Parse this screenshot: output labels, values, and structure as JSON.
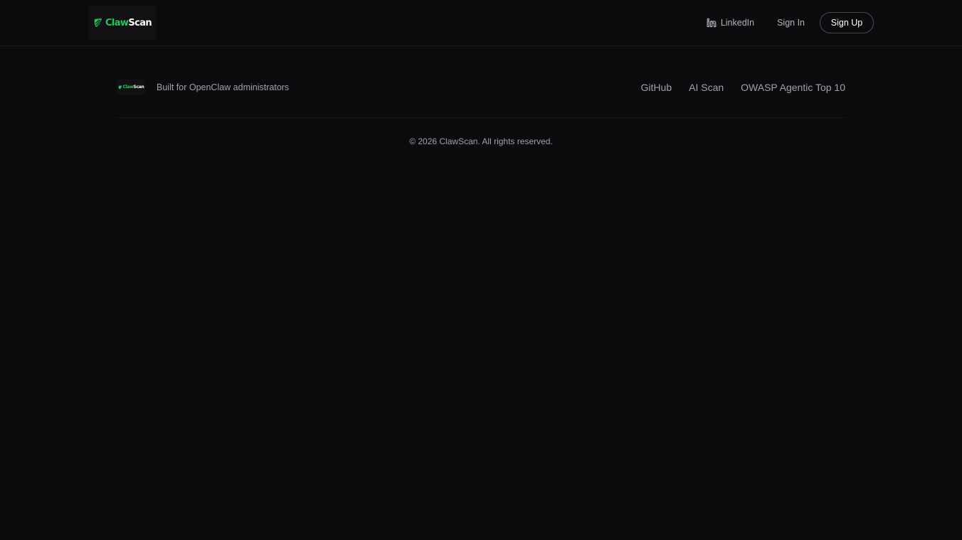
{
  "header": {
    "logo": {
      "claw": "Claw",
      "scan": "Scan",
      "icon": "shield-leaf-icon"
    },
    "nav": {
      "linkedin_label": "LinkedIn",
      "linkedin_icon": "linkedin-icon",
      "signin_label": "Sign In",
      "signup_label": "Sign Up"
    }
  },
  "footer": {
    "logo": {
      "claw": "Claw",
      "scan": "Scan"
    },
    "tagline": "Built for OpenClaw administrators",
    "links": [
      "GitHub",
      "AI Scan",
      "OWASP Agentic Top 10"
    ],
    "copyright": "© 2026 ClawScan. All rights reserved."
  },
  "colors": {
    "background": "#0b0b0d",
    "accent": "#22c55e",
    "text_muted": "#a1a1aa",
    "button_border": "#4a4a52"
  }
}
